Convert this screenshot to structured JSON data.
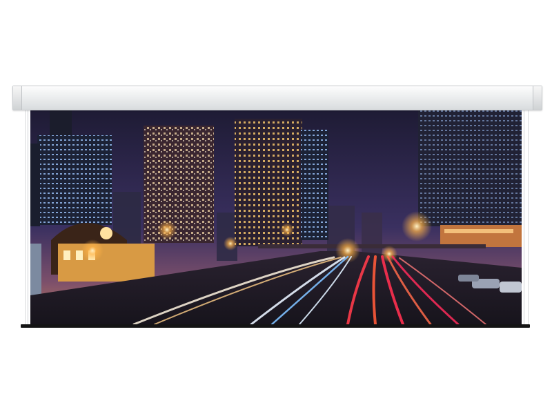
{
  "scene": {
    "sky_top": "#2a2440",
    "sky_bottom": "#8a5a6e",
    "glow_color": "#ffb347",
    "light_trail_red": "#ff3b4a",
    "light_trail_white": "#e8f2ff",
    "light_trail_blue": "#4aa8ff",
    "building_dark": "#1b1a24",
    "window_light": "#ffd27a",
    "window_cool": "#a8d4ff"
  }
}
